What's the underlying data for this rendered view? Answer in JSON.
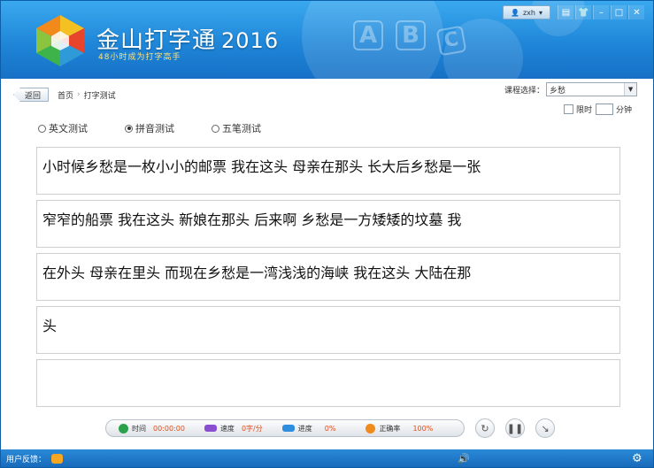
{
  "header": {
    "app_name": "金山打字通",
    "year": "2016",
    "slogan": "48小时成为打字高手",
    "decor_letters": [
      "A",
      "B",
      "C"
    ],
    "user": "zxh",
    "window_buttons": [
      "menu-icon",
      "skin-icon",
      "minimize-icon",
      "maximize-icon",
      "close-icon"
    ]
  },
  "nav": {
    "back_label": "返回",
    "breadcrumb": [
      "首页",
      "打字测试"
    ]
  },
  "course": {
    "label": "课程选择：",
    "selected": "乡愁"
  },
  "timer": {
    "limit_label": "限时",
    "minutes_value": "",
    "unit_label": "分钟"
  },
  "modes": [
    {
      "label": "英文测试",
      "selected": false
    },
    {
      "label": "拼音测试",
      "selected": true
    },
    {
      "label": "五笔测试",
      "selected": false
    }
  ],
  "lines": [
    "小时候乡愁是一枚小小的邮票 我在这头 母亲在那头 长大后乡愁是一张",
    "窄窄的船票 我在这头 新娘在那头 后来啊 乡愁是一方矮矮的坟墓 我",
    "在外头 母亲在里头 而现在乡愁是一湾浅浅的海峡 我在这头 大陆在那",
    "头",
    ""
  ],
  "stats": {
    "time_label": "时间",
    "time_value": "00:00:00",
    "speed_label": "速度",
    "speed_value": "0字/分",
    "progress_label": "进度",
    "progress_value": "0%",
    "accuracy_label": "正确率",
    "accuracy_value": "100%"
  },
  "footer": {
    "feedback_label": "用户反馈："
  },
  "colors": {
    "header_blue": "#1f86d8",
    "accent_red": "#e04f1f",
    "time_green": "#2aa14a",
    "speed_purple": "#8a4fd0",
    "progress_blue": "#2f8de0",
    "accuracy_orange": "#f08a1a"
  }
}
